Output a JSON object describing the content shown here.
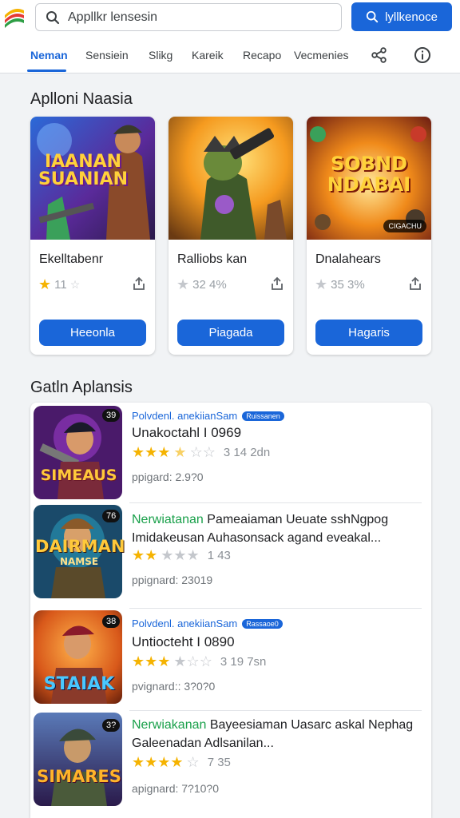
{
  "header": {
    "search_placeholder": "Appllkr lensesin",
    "search_button": "lyllkenoce"
  },
  "tabs": [
    {
      "label": "Neman",
      "active": true
    },
    {
      "label": "Sensiein"
    },
    {
      "label": "Slikg"
    },
    {
      "label": "Kareik"
    },
    {
      "label": "Recapo"
    },
    {
      "label": "Vecmenies"
    }
  ],
  "section1": {
    "title": "Aplloni Naasia",
    "cards": [
      {
        "art_text": "IAANAN SUANIAN",
        "name": "Ekelltabenr",
        "rating": "11",
        "button": "Heeonla"
      },
      {
        "art_text": "",
        "name": "Ralliobs kan",
        "rating": "32 4%",
        "button": "Piagada"
      },
      {
        "art_text": "SOBND NDABAI",
        "badge": "CIGACHU",
        "name": "Dnalahears",
        "rating": "35 3%",
        "button": "Hagaris"
      }
    ]
  },
  "section2": {
    "title": "Gatln Aplansis",
    "items": [
      {
        "num": "39",
        "thumb_text": "SIMEAUS",
        "developer": "Polvdenl. anekiianSam",
        "tag": "Ruissanen",
        "title": "Unakoctahl I 0969",
        "rating": "3 14 2dn",
        "meta": "ppigard: 2.9?0"
      },
      {
        "num": "76",
        "thumb_text": "DAIRMAN",
        "thumb_sub": "NAMSE",
        "developer": "Nerwiatanan",
        "desc": "Pameaiaman Ueuate sshNgpog Imidakeusan Auhasonsack agand eveakal...",
        "rating": "1 43",
        "meta": "ppignard: 23019"
      },
      {
        "num": "38",
        "thumb_text": "STAIAK",
        "developer": "Polvdenl. anekiianSam",
        "tag": "Rassaoe0",
        "title": "Untiocteht I 0890",
        "rating": "3 19 7sn",
        "meta": "pvignard:: 3?0?0"
      },
      {
        "num": "3?",
        "thumb_text": "SIMARES",
        "developer": "Nerwiakanan",
        "desc": "Bayeesiaman Uasarc askal Nephag Galeenadan Adlsanilan...",
        "rating": "7 35",
        "meta": "apignard: 7?10?0"
      }
    ]
  },
  "colors": {
    "accent": "#1a66d9",
    "star": "#f5b301",
    "green": "#19a04a"
  }
}
